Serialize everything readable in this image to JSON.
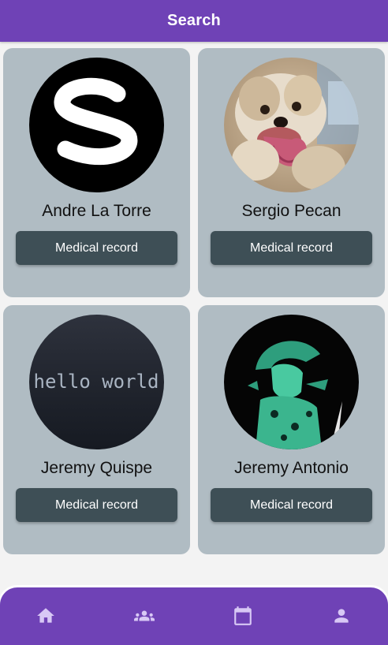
{
  "header": {
    "title": "Search"
  },
  "cards": [
    {
      "name": "Andre La Torre",
      "button": "Medical record",
      "avatar": "letter-s-logo"
    },
    {
      "name": "Sergio Pecan",
      "button": "Medical record",
      "avatar": "dog-photo"
    },
    {
      "name": "Jeremy Quispe",
      "button": "Medical record",
      "avatar": "hello-world-image",
      "avatar_text": "hello world"
    },
    {
      "name": "Jeremy Antonio",
      "button": "Medical record",
      "avatar": "green-character-art"
    }
  ],
  "bottom_nav": {
    "items": [
      {
        "icon": "home-icon"
      },
      {
        "icon": "group-icon"
      },
      {
        "icon": "calendar-icon"
      },
      {
        "icon": "person-icon"
      }
    ]
  },
  "colors": {
    "primary": "#6f42b6",
    "card": "#b0bcc3",
    "button": "#3e4f56",
    "background": "#f3f3f3",
    "nav_icon": "#d8c8f5"
  }
}
